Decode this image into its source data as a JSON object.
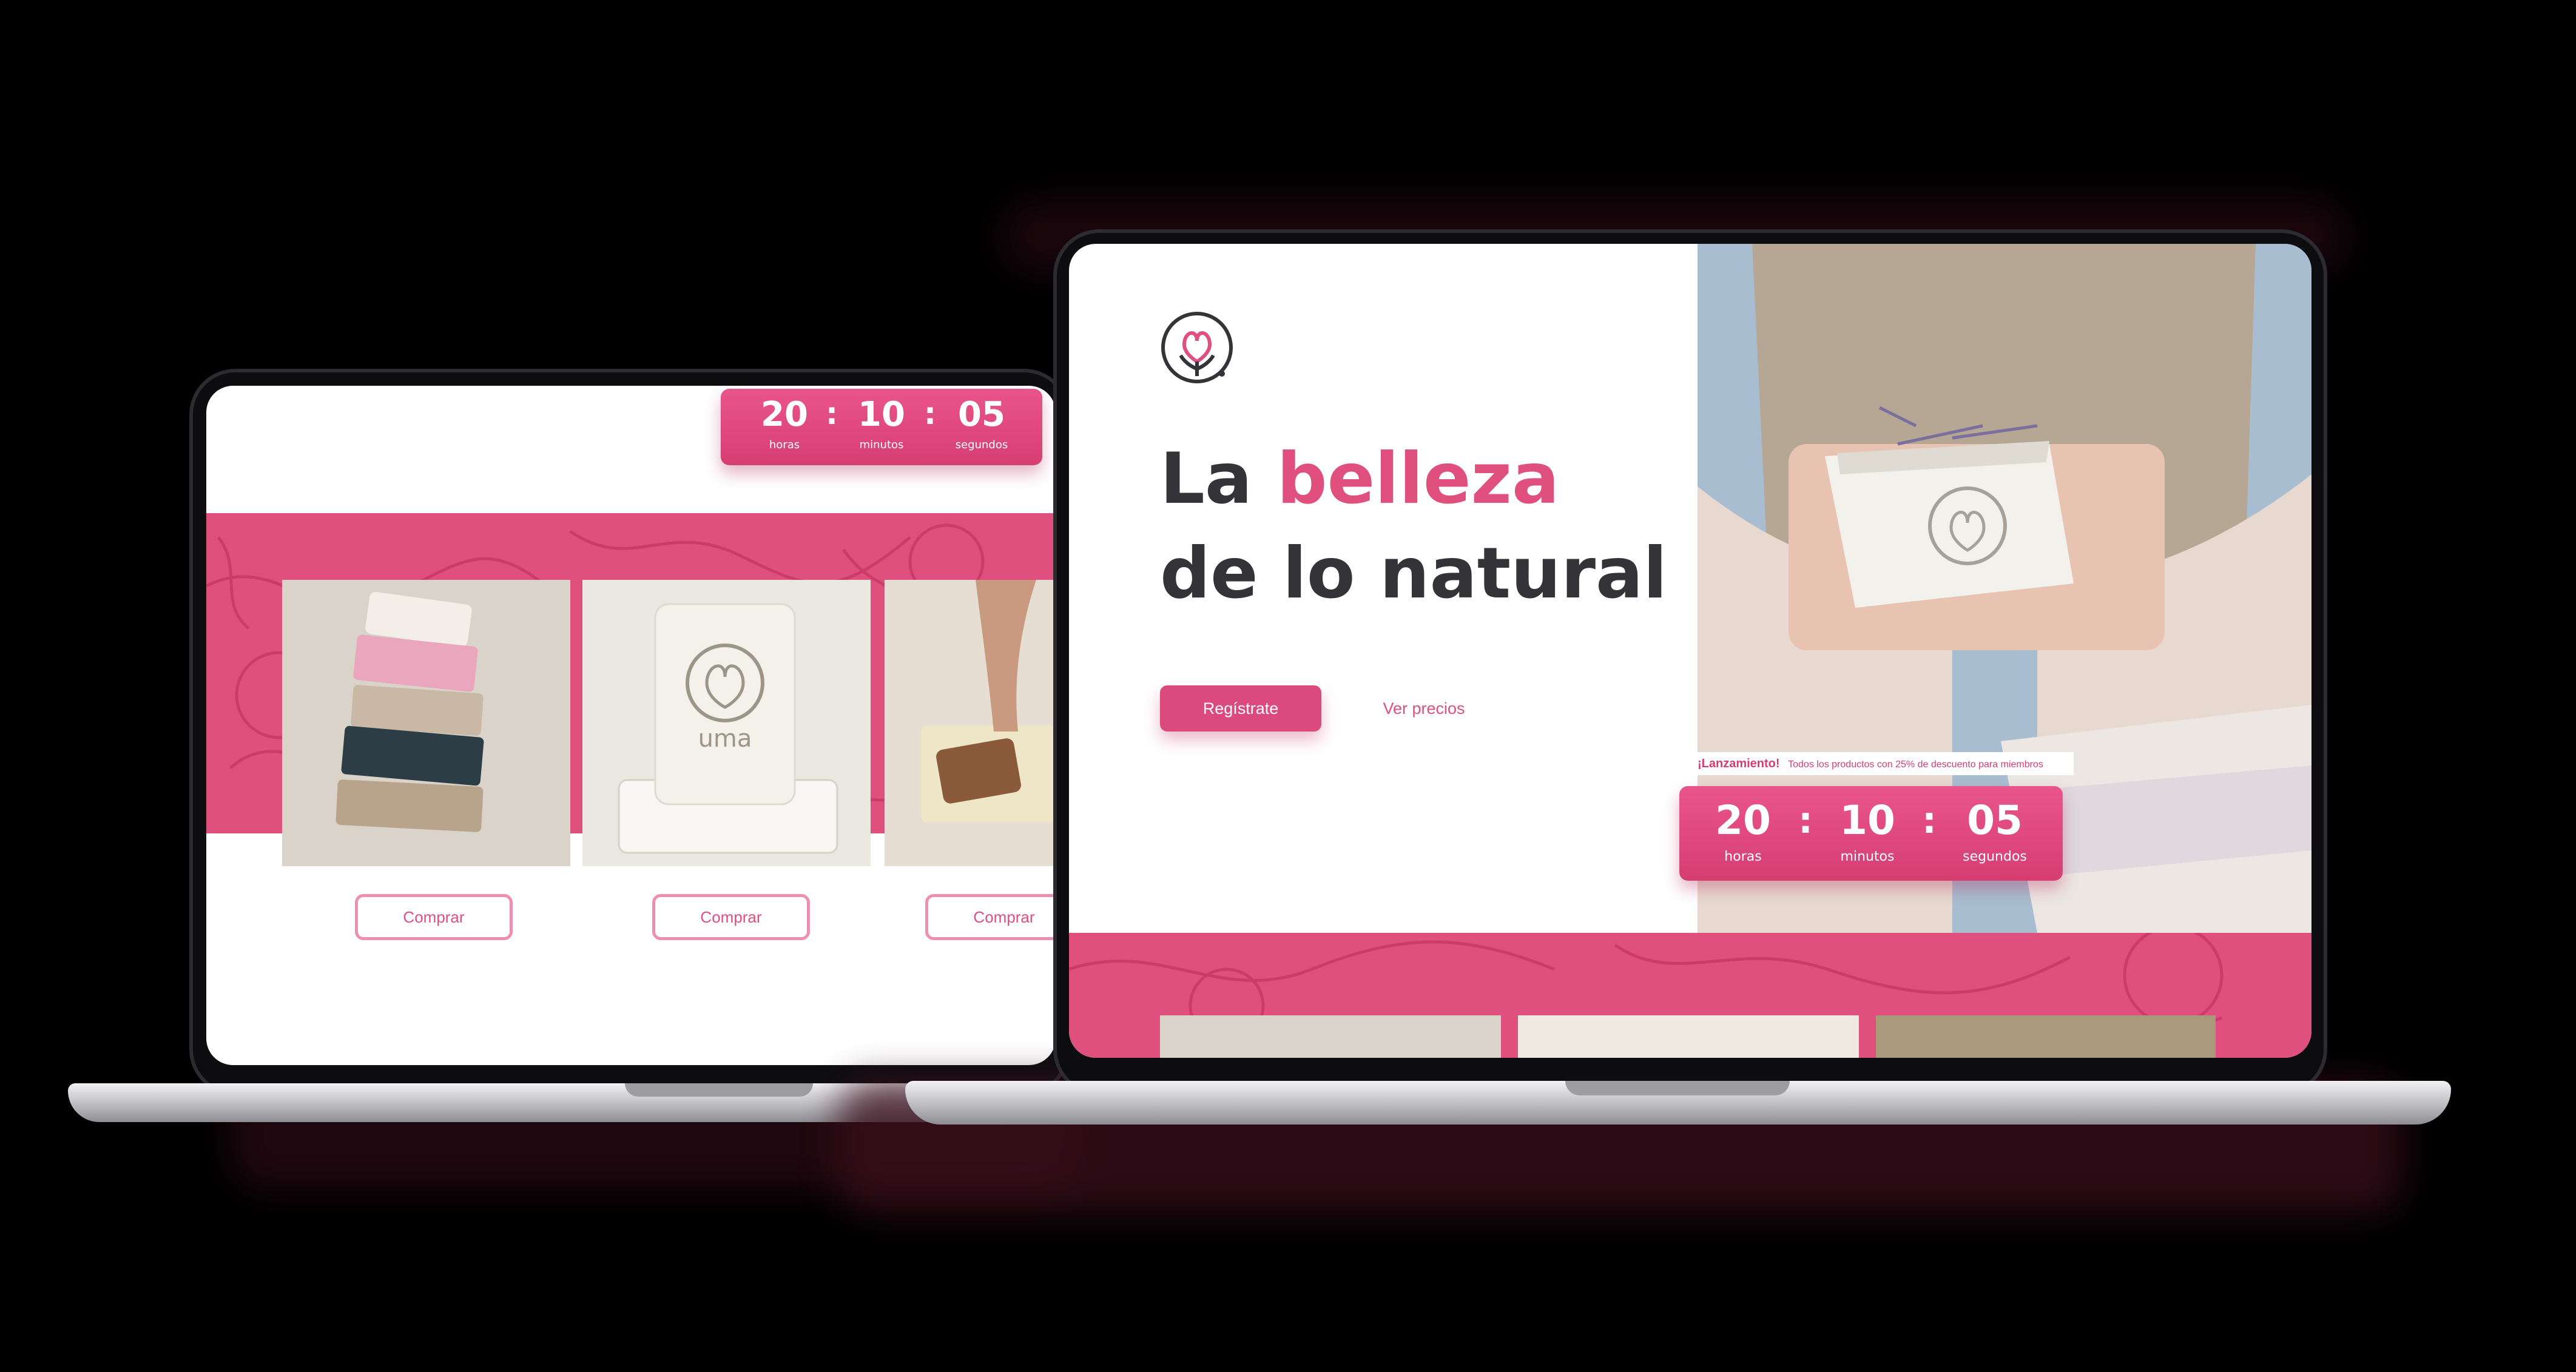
{
  "brand": {
    "name": "uma",
    "accent": "#e0507e",
    "dark_text": "#343438"
  },
  "hero": {
    "title_line1_prefix": "La",
    "title_line1_highlight": "belleza",
    "title_line2": "de lo natural",
    "primary_cta": "Regístrate",
    "secondary_cta": "Ver precios"
  },
  "promo": {
    "label": "¡Lanzamiento!",
    "text": "Todos los productos con 25% de descuento para miembros"
  },
  "countdown": {
    "hours": "20",
    "hours_label": "horas",
    "minutes": "10",
    "minutes_label": "minutos",
    "seconds": "05",
    "seconds_label": "segundos",
    "separator": ":"
  },
  "products": {
    "buy_label": "Comprar",
    "soap_stamp": "uma"
  },
  "icons": {
    "logo": "flower-heart-logo-icon"
  }
}
